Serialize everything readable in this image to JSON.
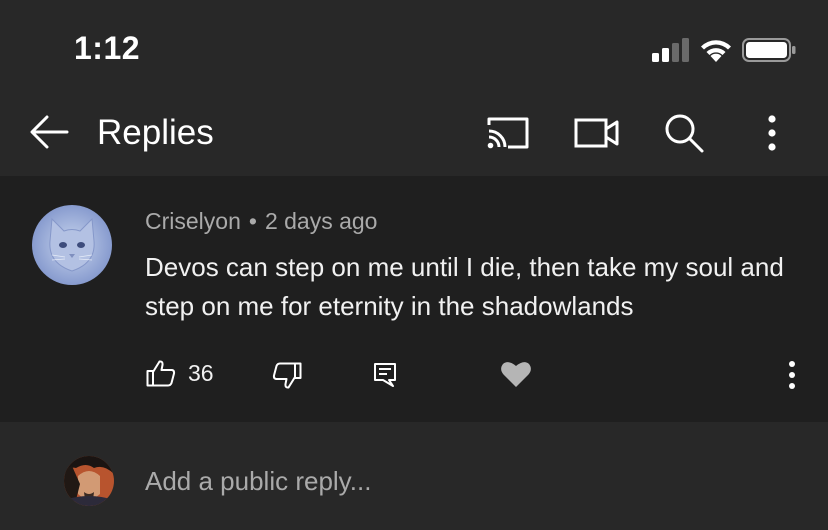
{
  "status_bar": {
    "time": "1:12"
  },
  "app_bar": {
    "title": "Replies",
    "icons": [
      "back-arrow-icon",
      "cast-icon",
      "video-camera-icon",
      "search-icon",
      "more-vert-icon"
    ]
  },
  "comment": {
    "author": "Criselyon",
    "separator": "•",
    "timestamp": "2 days ago",
    "text": "Devos can step on me until I die, then take my soul and step on me for eternity in the shadowlands",
    "likes": "36"
  },
  "reply_box": {
    "placeholder": "Add a public reply..."
  },
  "colors": {
    "background": "#282828",
    "comment_bg": "#1f1f1f",
    "text": "#f1f1f1",
    "secondary": "#aaaaaa"
  }
}
